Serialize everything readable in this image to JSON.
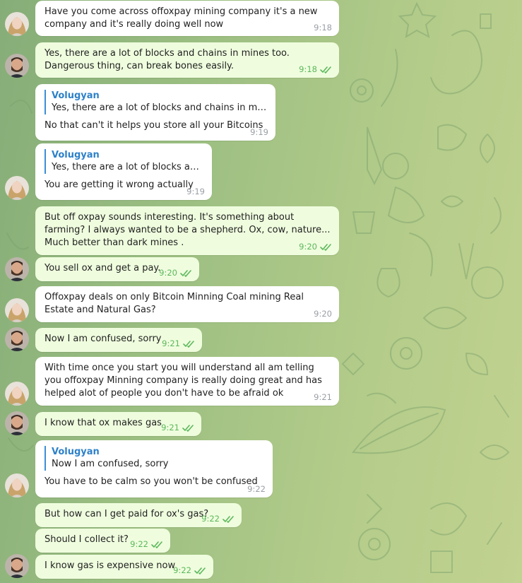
{
  "chat": {
    "messages": [
      {
        "text": "Have you come across offoxpay mining company it's a new company and it's really doing well now",
        "time": "9:18"
      },
      {
        "text": "Yes, there are a lot of blocks and chains in mines too. Dangerous thing, can break bones easily.",
        "time": "9:18"
      },
      {
        "reply_name": "Volugyan",
        "reply_text": "Yes, there are a lot of blocks and chains in mines t...",
        "text": "No that can't it helps you store all your Bitcoins",
        "time": "9:19"
      },
      {
        "reply_name": "Volugyan",
        "reply_text": "Yes, there are a lot of blocks and c...",
        "text": "You are getting it wrong actually",
        "time": "9:19"
      },
      {
        "text": "But off oxpay sounds interesting. It's something about farming? I always wanted to be a shepherd. Ox, cow, nature... Much better than dark mines .",
        "time": "9:20"
      },
      {
        "text": "You sell ox and get a pay.",
        "time": "9:20"
      },
      {
        "text": "Offoxpay deals on only Bitcoin Minning Coal mining Real Estate and Natural Gas?",
        "time": "9:20"
      },
      {
        "text": "Now I am confused, sorry",
        "time": "9:21"
      },
      {
        "text": "With time once you start you will understand all am telling you offoxpay Minning company is really doing great and has helped alot of people you don't have to be afraid ok",
        "time": "9:21"
      },
      {
        "text": "I know that ox makes gas",
        "time": "9:21"
      },
      {
        "reply_name": "Volugyan",
        "reply_text": "Now I am confused, sorry",
        "text": "You have to be calm so you won't be confused",
        "time": "9:22"
      },
      {
        "text": "But how can I get paid for ox's gas?",
        "time": "9:22"
      },
      {
        "text": "Should I collect it?",
        "time": "9:22"
      },
      {
        "text": "I know gas is expensive now",
        "time": "9:22"
      }
    ]
  },
  "colors": {
    "incoming_bubble": "#ffffff",
    "outgoing_bubble": "#effdde",
    "read_check": "#5cb85c",
    "reply_accent": "#3b8fd5"
  },
  "icons": {
    "read_receipt": "double-check-icon",
    "avatar_contact": "blonde-woman-avatar",
    "avatar_self": "bearded-man-avatar"
  }
}
